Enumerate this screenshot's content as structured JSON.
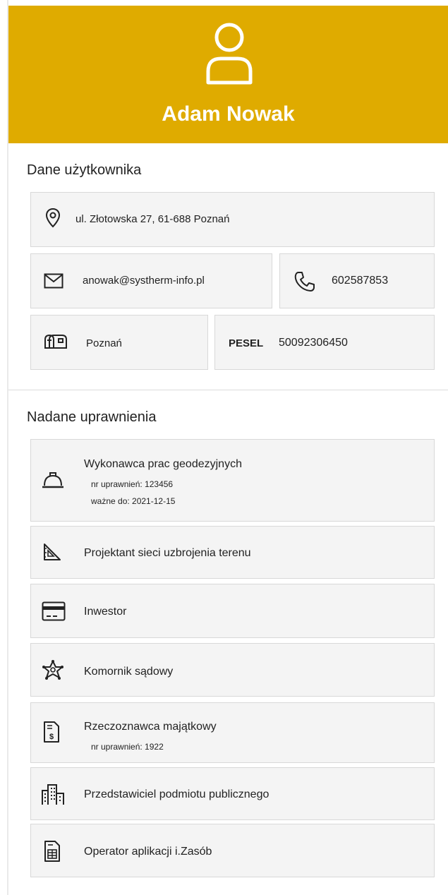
{
  "user": {
    "name": "Adam Nowak",
    "icon": "user-icon"
  },
  "user_data": {
    "title": "Dane użytkownika",
    "address": "ul. Złotowska 27, 61-688 Poznań",
    "email": "anowak@systherm-info.pl",
    "phone": "602587853",
    "city": "Poznań",
    "pesel_label": "PESEL",
    "pesel": "50092306450"
  },
  "permissions": {
    "title": "Nadane uprawnienia",
    "items": [
      {
        "label": "Wykonawca prac geodezyjnych",
        "detail1": "nr uprawnień: 123456",
        "detail2": "ważne do: 2021-12-15",
        "icon": "hard-hat-icon"
      },
      {
        "label": "Projektant sieci uzbrojenia terenu",
        "icon": "set-square-icon"
      },
      {
        "label": "Inwestor",
        "icon": "credit-card-icon"
      },
      {
        "label": "Komornik sądowy",
        "icon": "sheriff-badge-icon"
      },
      {
        "label": "Rzeczoznawca majątkowy",
        "detail1": "nr uprawnień: 1922",
        "icon": "invoice-dollar-icon"
      },
      {
        "label": "Przedstawiciel podmiotu publicznego",
        "icon": "city-buildings-icon"
      },
      {
        "label": "Operator aplikacji i.Zasób",
        "icon": "spreadsheet-document-icon"
      }
    ]
  },
  "colors": {
    "header": "#dfab00",
    "card": "#f4f4f4",
    "border": "#d8d8d8"
  }
}
